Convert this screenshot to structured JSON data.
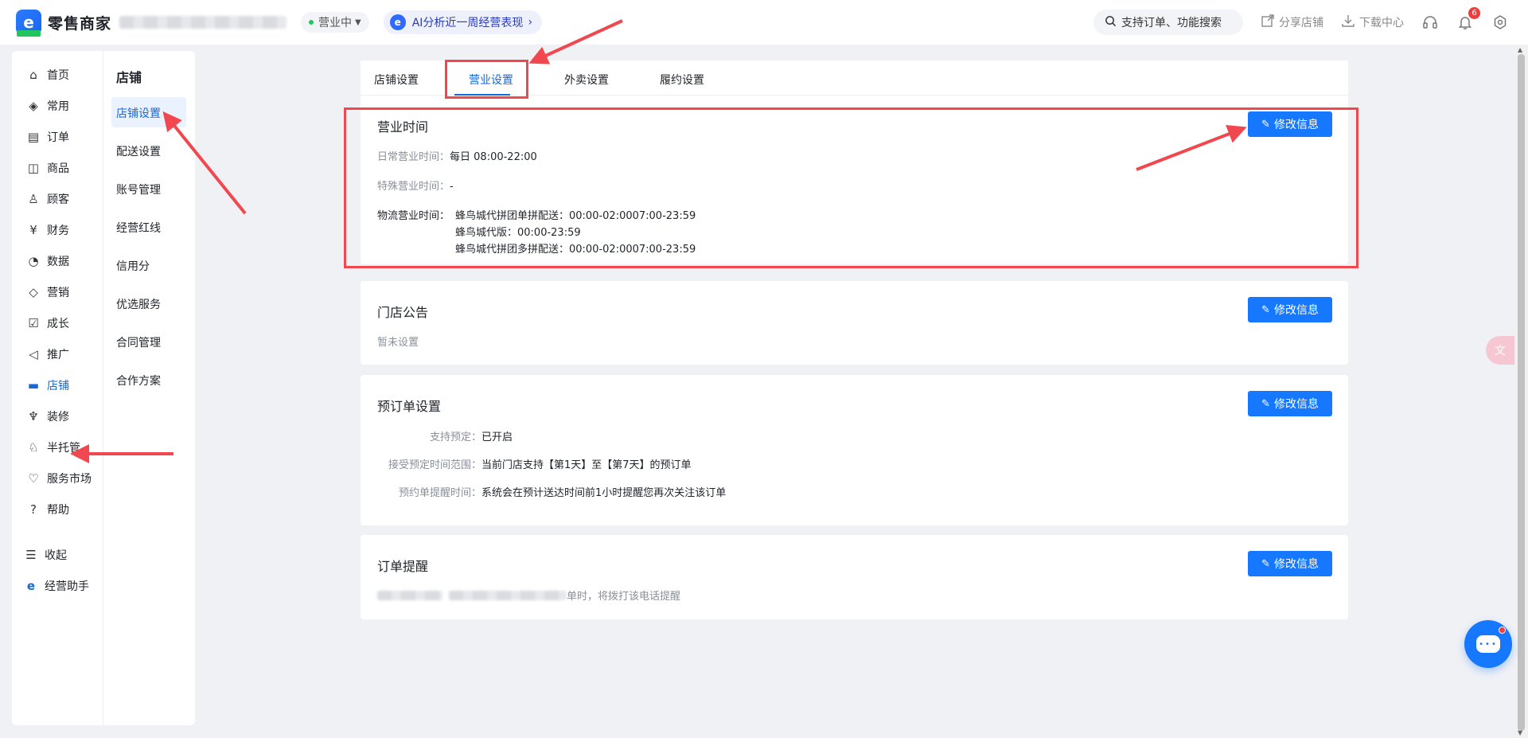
{
  "header": {
    "app_name": "零售商家",
    "status": "营业中",
    "ai_banner": "AI分析近一周经营表现",
    "search_placeholder": "支持订单、功能搜索",
    "share_label": "分享店铺",
    "download_label": "下载中心",
    "notification_count": "6"
  },
  "nav": {
    "items": [
      {
        "label": "首页",
        "icon": "home-icon"
      },
      {
        "label": "常用",
        "icon": "layers-icon"
      },
      {
        "label": "订单",
        "icon": "order-icon"
      },
      {
        "label": "商品",
        "icon": "bag-icon"
      },
      {
        "label": "顾客",
        "icon": "user-icon"
      },
      {
        "label": "财务",
        "icon": "finance-icon"
      },
      {
        "label": "数据",
        "icon": "pie-icon"
      },
      {
        "label": "营销",
        "icon": "diamond-icon"
      },
      {
        "label": "成长",
        "icon": "growth-icon"
      },
      {
        "label": "推广",
        "icon": "megaphone-icon"
      },
      {
        "label": "店铺",
        "icon": "store-icon"
      },
      {
        "label": "装修",
        "icon": "brush-icon"
      },
      {
        "label": "半托管",
        "icon": "hosting-icon"
      },
      {
        "label": "服务市场",
        "icon": "heart-icon"
      },
      {
        "label": "帮助",
        "icon": "help-icon"
      }
    ],
    "collapse": "收起",
    "assistant": "经营助手"
  },
  "subnav": {
    "title": "店铺",
    "items": [
      "店铺设置",
      "配送设置",
      "账号管理",
      "经营红线",
      "信用分",
      "优选服务",
      "合同管理",
      "合作方案"
    ]
  },
  "tabs": [
    "店铺设置",
    "营业设置",
    "外卖设置",
    "履约设置"
  ],
  "business_hours": {
    "title": "营业时间",
    "button": "修改信息",
    "daily_label": "日常营业时间：",
    "daily_value": "每日 08:00-22:00",
    "special_label": "特殊营业时间：",
    "special_value": "-",
    "logistics_label": "物流营业时间：",
    "logistics": [
      "蜂鸟城代拼团单拼配送：00:00-02:0007:00-23:59",
      "蜂鸟城代版：00:00-23:59",
      "蜂鸟城代拼团多拼配送：00:00-02:0007:00-23:59"
    ]
  },
  "announcement": {
    "title": "门店公告",
    "button": "修改信息",
    "value": "暂未设置"
  },
  "preorder": {
    "title": "预订单设置",
    "button": "修改信息",
    "support_label": "支持预定：",
    "support_value": "已开启",
    "range_label": "接受预定时间范围：",
    "range_value": "当前门店支持【第1天】至【第7天】的预订单",
    "remind_label": "预约单提醒时间：",
    "remind_value": "系统会在预计送达时间前1小时提醒您再次关注该订单"
  },
  "order_reminder": {
    "title": "订单提醒",
    "button": "修改信息",
    "value_suffix": "单时，将拨打该电话提醒"
  },
  "colors": {
    "primary": "#1677ff",
    "annotation": "#f0484e",
    "status_green": "#22c55e"
  }
}
